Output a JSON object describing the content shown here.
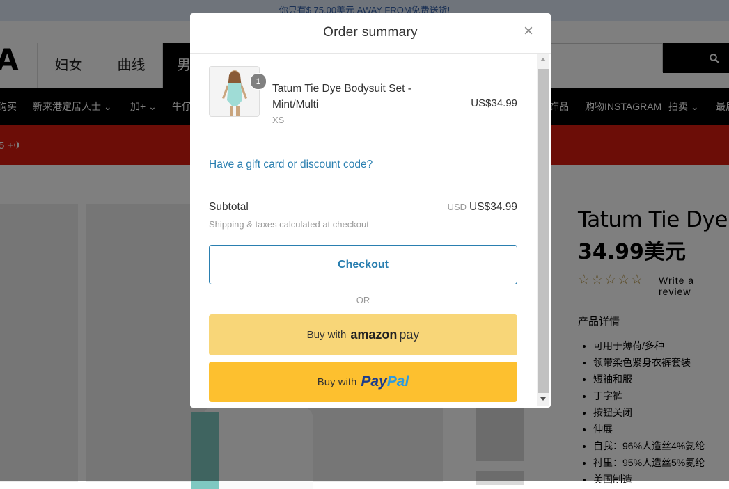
{
  "announcement": "你只有$ 75.00美元 AWAY FROM免费送货!",
  "header": {
    "logo": "A",
    "category_tabs": [
      "妇女",
      "曲线",
      "男"
    ],
    "search_icon": "search-icon"
  },
  "nav": {
    "items": [
      "购买",
      "新来港定居人士",
      "加+",
      "牛仔",
      "饰品",
      "购物INSTAGRAM",
      "拍卖",
      "最后"
    ]
  },
  "promo": {
    "text": "5 +"
  },
  "product": {
    "title": "Tatum Tie Dye紧",
    "price": "34.99美元",
    "stars": "☆☆☆☆☆",
    "review_link": "Write a review",
    "details_title": "产品详情",
    "details": [
      "可用于薄荷/多种",
      "领带染色紧身衣裤套装",
      "短袖和服",
      "丁字裤",
      "按钮关闭",
      "伸展",
      "自我：96%人造丝4%氨纶",
      "衬里：95%人造丝5%氨纶",
      "美国制造"
    ]
  },
  "modal": {
    "title": "Order summary",
    "close_icon": "close-icon",
    "item": {
      "quantity": "1",
      "name": "Tatum Tie Dye Bodysuit Set - Mint/Multi",
      "variant": "XS",
      "price": "US$34.99"
    },
    "gift_link": "Have a gift card or discount code?",
    "subtotal_label": "Subtotal",
    "subtotal_currency": "USD",
    "subtotal_value": "US$34.99",
    "shipping_note": "Shipping & taxes calculated at checkout",
    "checkout_label": "Checkout",
    "or_label": "OR",
    "amazon": {
      "prefix": "Buy with",
      "brand": "amazon",
      "suffix": "pay"
    },
    "paypal": {
      "prefix": "Buy with",
      "brand_a": "Pay",
      "brand_b": "Pal"
    }
  },
  "colors": {
    "link_blue": "#2a7fb0",
    "amazon_yellow": "#f8d678",
    "paypal_yellow": "#fdc02f",
    "promo_red": "#d81b0e"
  }
}
